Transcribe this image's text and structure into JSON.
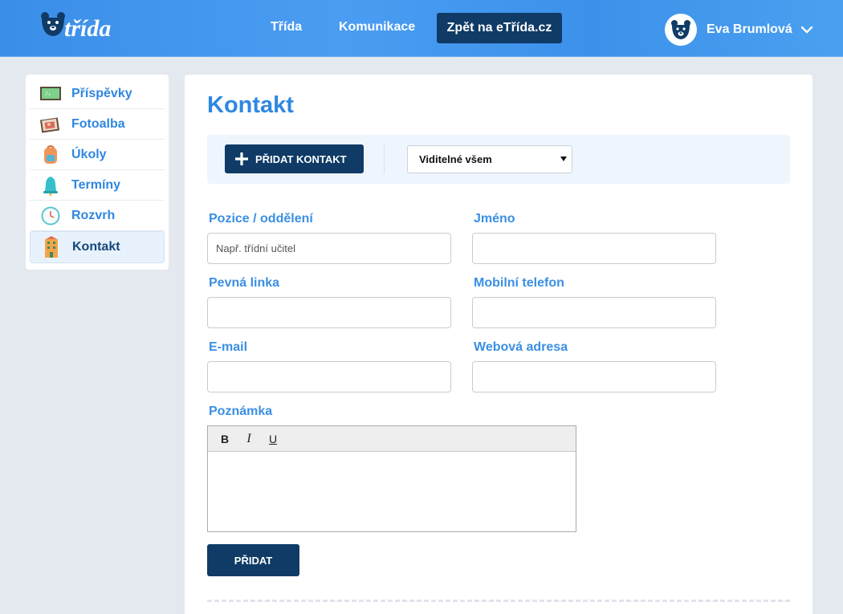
{
  "header": {
    "logo_text": "etřída",
    "nav": [
      {
        "label": "Třída"
      },
      {
        "label": "Komunikace"
      }
    ],
    "back_button": "Zpět na eTřída.cz",
    "user": {
      "name": "Eva Brumlová"
    }
  },
  "sidebar": {
    "items": [
      {
        "label": "Příspěvky",
        "icon": "chalkboard-icon"
      },
      {
        "label": "Fotoalba",
        "icon": "photo-album-icon"
      },
      {
        "label": "Úkoly",
        "icon": "backpack-icon"
      },
      {
        "label": "Termíny",
        "icon": "bell-icon"
      },
      {
        "label": "Rozvrh",
        "icon": "clock-icon"
      },
      {
        "label": "Kontakt",
        "icon": "building-icon",
        "active": true
      }
    ]
  },
  "main": {
    "title": "Kontakt",
    "toolbar": {
      "add_button": "PŘIDAT KONTAKT",
      "visibility_value": "Viditelné všem"
    },
    "form": {
      "position_label": "Pozice / oddělení",
      "position_placeholder": "Např. třídní učitel",
      "name_label": "Jméno",
      "phone_label": "Pevná linka",
      "mobile_label": "Mobilní telefon",
      "email_label": "E-mail",
      "web_label": "Webová adresa",
      "note_label": "Poznámka",
      "editor_buttons": {
        "bold": "B",
        "italic": "I",
        "underline": "U"
      },
      "submit": "PŘIDAT"
    }
  },
  "colors": {
    "header_blue": "#3a8ee8",
    "navy": "#0f3b66",
    "label_blue": "#3a8fe3",
    "page_bg": "#e4e9ef"
  }
}
